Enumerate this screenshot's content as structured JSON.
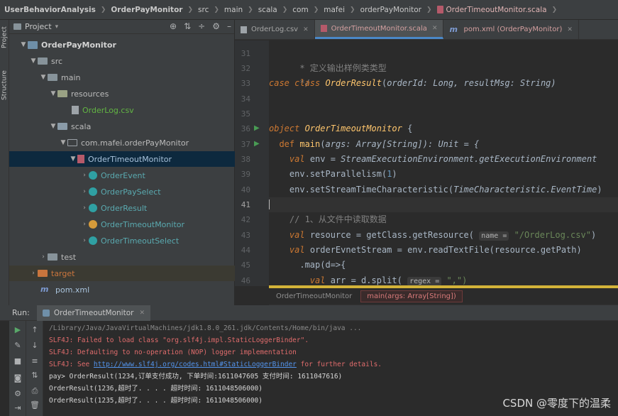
{
  "breadcrumb": {
    "items": [
      "UserBehaviorAnalysis",
      "OrderPayMonitor",
      "src",
      "main",
      "scala",
      "com",
      "mafei",
      "orderPayMonitor",
      "OrderTimeoutMonitor.scala"
    ]
  },
  "side_strip": {
    "project_label": "Project",
    "structure_label": "Structure"
  },
  "project_panel": {
    "title": "Project",
    "tree": [
      {
        "label": "OrderPayMonitor",
        "icon": "module-icon"
      },
      {
        "label": "src",
        "icon": "folder-icon"
      },
      {
        "label": "main",
        "icon": "folder-icon"
      },
      {
        "label": "resources",
        "icon": "resources-folder-icon"
      },
      {
        "label": "OrderLog.csv",
        "icon": "csv-file-icon"
      },
      {
        "label": "scala",
        "icon": "source-folder-icon"
      },
      {
        "label": "com.mafei.orderPayMonitor",
        "icon": "package-icon"
      },
      {
        "label": "OrderTimeoutMonitor",
        "icon": "scala-file-icon"
      },
      {
        "label": "OrderEvent",
        "icon": "scala-class-icon"
      },
      {
        "label": "OrderPaySelect",
        "icon": "scala-class-icon"
      },
      {
        "label": "OrderResult",
        "icon": "scala-class-icon"
      },
      {
        "label": "OrderTimeoutMonitor",
        "icon": "scala-object-icon"
      },
      {
        "label": "OrderTimeoutSelect",
        "icon": "scala-class-icon"
      },
      {
        "label": "test",
        "icon": "folder-icon"
      },
      {
        "label": "target",
        "icon": "excluded-folder-icon"
      },
      {
        "label": "pom.xml",
        "icon": "maven-icon"
      }
    ]
  },
  "editor_tabs": [
    {
      "label": "OrderLog.csv"
    },
    {
      "label": "OrderTimeoutMonitor.scala"
    },
    {
      "label": "pom.xml (OrderPayMonitor)"
    }
  ],
  "editor": {
    "line_numbers": [
      "31",
      "32",
      "33",
      "34",
      "35",
      "36",
      "37",
      "38",
      "39",
      "40",
      "41",
      "42",
      "43",
      "44",
      "45",
      "46"
    ],
    "current_line": "41",
    "code": {
      "l31": "* 定义输出样例类类型",
      "l32": "*/",
      "l33_kw": "case class ",
      "l33_name": "OrderResult",
      "l33_rest_a": "(",
      "l33_p1": "orderId",
      "l33_t1": ": Long, ",
      "l33_p2": "resultMsg",
      "l33_t2": ": String)",
      "l36_kw": "object ",
      "l36_name": "OrderTimeoutMonitor",
      "l36_rest": " {",
      "l37_kw": "def ",
      "l37_name": "main",
      "l37_rest_a": "(",
      "l37_param": "args",
      "l37_rest_b": ": Array[String]): Unit = {",
      "l38_kw": "val ",
      "l38_rest": "env = ",
      "l38_call": "StreamExecutionEnvironment.getExecutionEnvironment",
      "l39": "env.setParallelism(",
      "l39_num": "1",
      "l39_end": ")",
      "l40": "env.setStreamTimeCharacteristic(",
      "l40_arg": "TimeCharacteristic.EventTime",
      "l40_end": ")",
      "l42": "// 1、从文件中读取数据",
      "l43_kw": "val ",
      "l43_rest": "resource = getClass.getResource( ",
      "l43_hint": "name =",
      "l43_str": " \"/OrderLog.csv\"",
      "l43_end": ")",
      "l44_kw": "val ",
      "l44_rest": "orderEvnetStream = env.readTextFile(resource.getPath)",
      "l45": ".map(d=>{",
      "l46_kw": "val ",
      "l46_rest": "arr = d.split( ",
      "l46_hint": "regex =",
      "l46_str": " \",\")"
    }
  },
  "editor_breadcrumb": [
    "OrderTimeoutMonitor",
    "main(args: Array[String])"
  ],
  "run_panel": {
    "label": "Run:",
    "tab": "OrderTimeoutMonitor",
    "console": [
      {
        "text": "/Library/Java/JavaVirtualMachines/jdk1.8.0_261.jdk/Contents/Home/bin/java ...",
        "style": "gray"
      },
      {
        "text": "SLF4J: Failed to load class \"org.slf4j.impl.StaticLoggerBinder\".",
        "style": "red"
      },
      {
        "text": "SLF4J: Defaulting to no-operation (NOP) logger implementation",
        "style": "red"
      },
      {
        "prefix": "SLF4J: See ",
        "link": "http://www.slf4j.org/codes.html#StaticLoggerBinder",
        "suffix": " for further details.",
        "style": "red"
      },
      {
        "text": "pay> OrderResult(1234,订单支付成功, 下单时间:1611047605 支付时间: 1611047616)",
        "style": "white"
      },
      {
        "text": "OrderResult(1236,超时了. . . . 超时时间: 1611048506000)",
        "style": "white"
      },
      {
        "text": "OrderResult(1235,超时了. . . . 超时时间: 1611048506000)",
        "style": "white"
      }
    ]
  },
  "watermark": "CSDN @零度下的温柔",
  "colors": {
    "accent": "#4a88c7",
    "selection": "#0d293e",
    "keyword": "#cc7832",
    "function": "#ffc66d",
    "string": "#6a8759",
    "error_text": "#e06c6c"
  }
}
